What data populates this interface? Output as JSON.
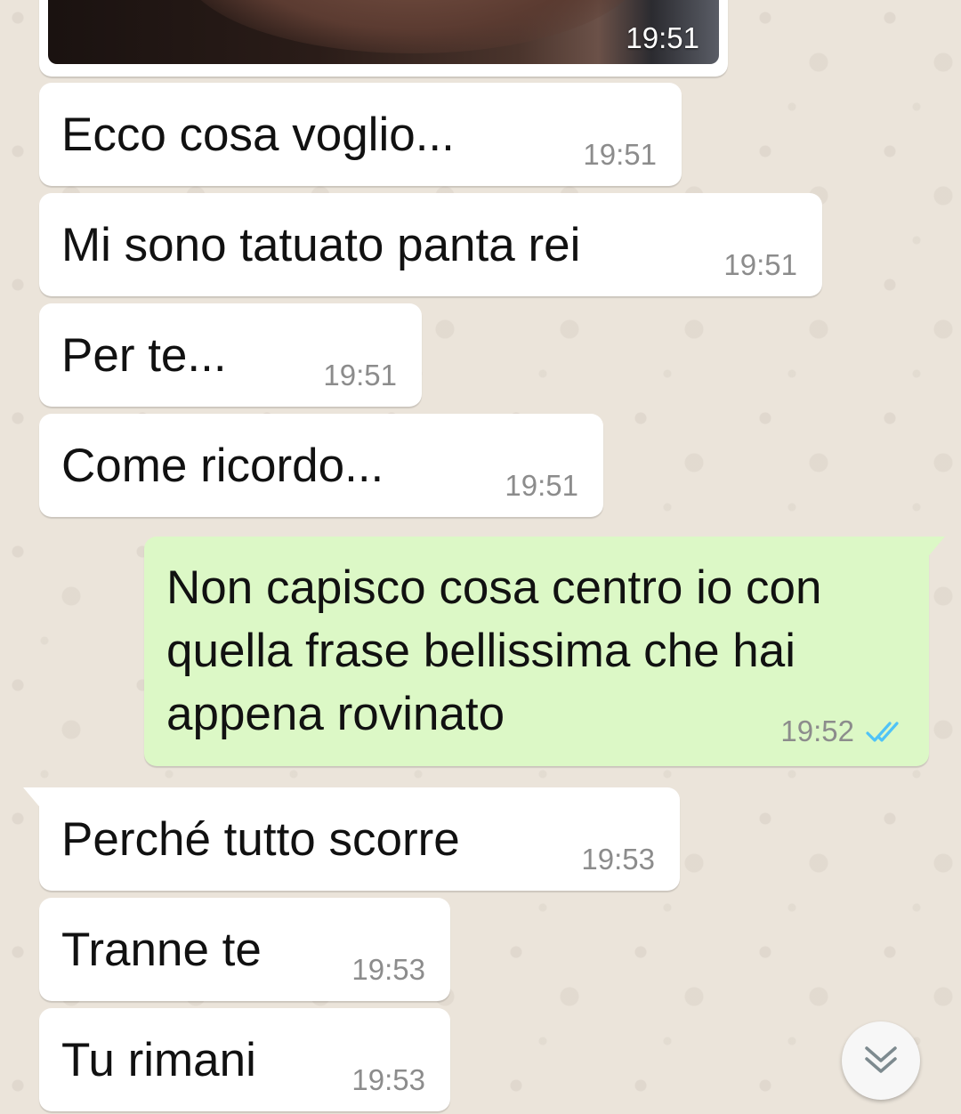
{
  "image_message": {
    "time": "19:51"
  },
  "messages": [
    {
      "text": "Ecco cosa voglio...",
      "time": "19:51"
    },
    {
      "text": "Mi sono tatuato panta rei",
      "time": "19:51"
    },
    {
      "text": "Per te...",
      "time": "19:51"
    },
    {
      "text": "Come ricordo...",
      "time": "19:51"
    },
    {
      "text": "Non capisco cosa centro io con quella frase bellissima che hai appena rovinato",
      "time": "19:52",
      "status": "read"
    },
    {
      "text": "Perché tutto scorre",
      "time": "19:53"
    },
    {
      "text": "Tranne te",
      "time": "19:53"
    },
    {
      "text": "Tu rimani",
      "time": "19:53"
    }
  ],
  "colors": {
    "incoming_bubble": "#ffffff",
    "outgoing_bubble": "#dcf8c6",
    "read_ticks": "#4fc3f7",
    "wallpaper": "#ebe4da"
  },
  "icons": {
    "read_status": "double-check-icon",
    "scroll_down": "double-chevron-down-icon"
  }
}
